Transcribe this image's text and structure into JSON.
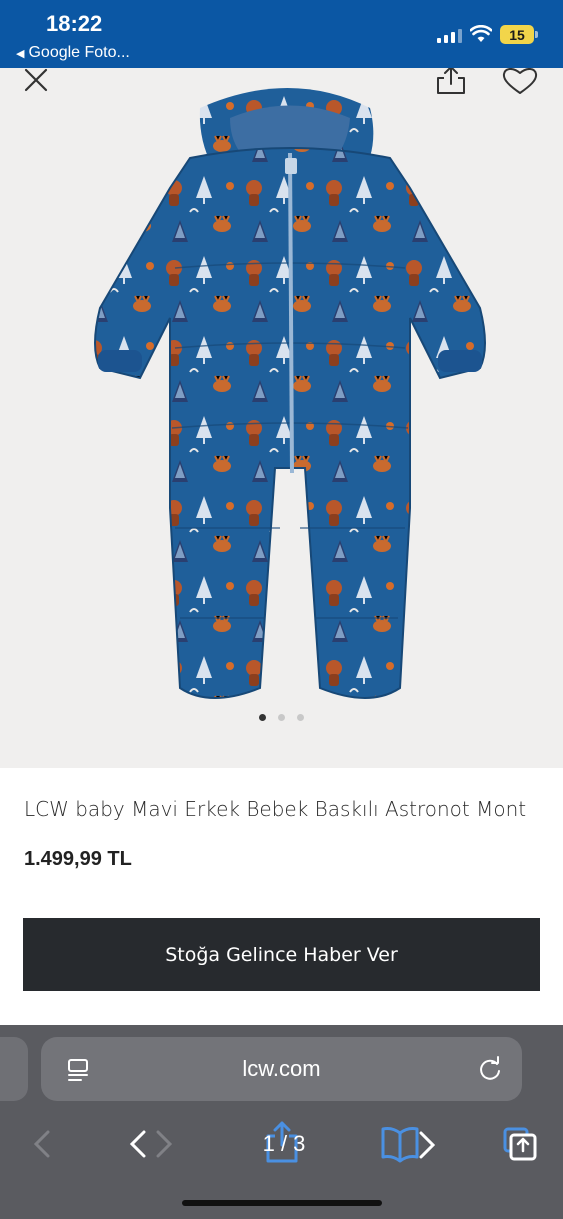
{
  "status_bar": {
    "time": "18:22",
    "back_app_label": "Google Foto...",
    "battery_level": "15"
  },
  "gallery": {
    "close_icon": "close-icon",
    "share_icon": "share-icon",
    "favorite_icon": "heart-icon",
    "image_alt": "baby snowsuit with forest animals print",
    "dots_total": 3,
    "dots_active": 1
  },
  "product": {
    "title": "LCW baby Mavi Erkek Bebek Baskılı Astronot Mont",
    "price": "1.499,99 TL",
    "notify_button": "Stoğa Gelince Haber Ver"
  },
  "browser": {
    "url": "lcw.com",
    "page_indicator": "1 / 3",
    "colors": {
      "chrome": "#5a5b60",
      "urlbar": "#737479",
      "accent": "#4a90e2"
    }
  },
  "colors": {
    "status_bar": "#0b57a4",
    "button_dark": "#272a2e",
    "gallery_bg": "#f0efee"
  }
}
